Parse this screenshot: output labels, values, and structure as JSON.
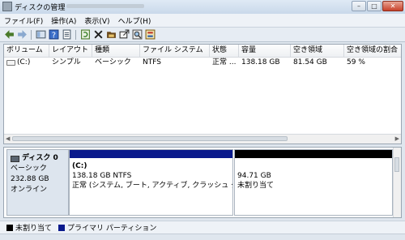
{
  "window": {
    "title": "ディスクの管理",
    "icon": "disk-management-icon"
  },
  "menu": [
    "ファイル(F)",
    "操作(A)",
    "表示(V)",
    "ヘルプ(H)"
  ],
  "toolbar": [
    "back-arrow-icon",
    "forward-arrow-icon",
    "console-icon",
    "help-icon",
    "properties-icon",
    "refresh-icon",
    "delete-icon",
    "folder-icon",
    "export-icon",
    "search-icon",
    "settings-icon"
  ],
  "volume_table": {
    "headers": [
      "ボリューム",
      "レイアウト",
      "種類",
      "ファイル システム",
      "状態",
      "容量",
      "空き領域",
      "空き領域の割合"
    ],
    "row": [
      "(C:)",
      "シンプル",
      "ベーシック",
      "NTFS",
      "正常 ...",
      "138.18 GB",
      "81.54 GB",
      "59 %"
    ]
  },
  "disk": {
    "name": "ディスク 0",
    "type": "ベーシック",
    "size": "232.88 GB",
    "status": "オンライン",
    "partitions": [
      {
        "label": "(C:)",
        "size": "138.18 GB NTFS",
        "status": "正常 (システム, ブート, アクティブ, クラッシュ ダン",
        "bar_color": "#0a1a8c"
      },
      {
        "label": "",
        "size": "94.71 GB",
        "status": "未割り当て",
        "bar_color": "#000000"
      }
    ]
  },
  "legend": [
    {
      "label": "未割り当て",
      "color": "#000000"
    },
    {
      "label": "プライマリ パーティション",
      "color": "#0a1a8c"
    }
  ]
}
